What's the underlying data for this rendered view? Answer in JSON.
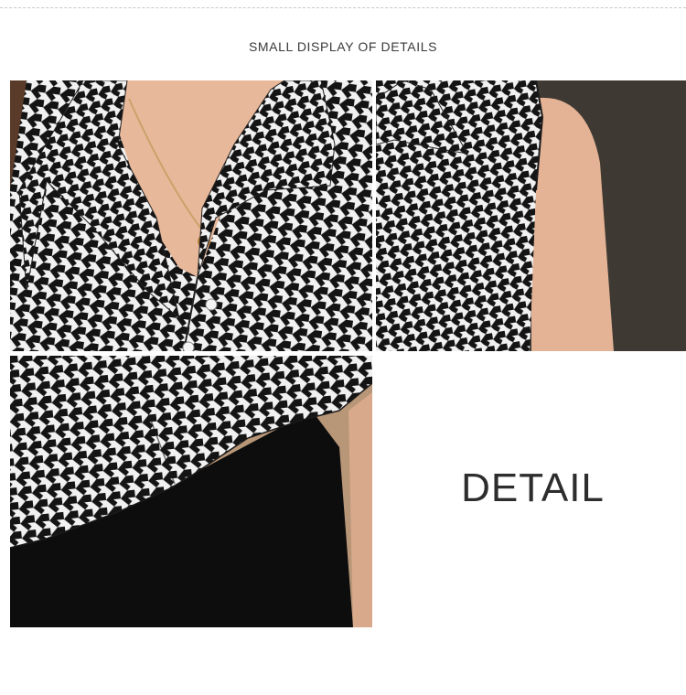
{
  "header": {
    "title": "SMALL DISPLAY OF DETAILS"
  },
  "panels": [
    {
      "name": "collar-detail-photo"
    },
    {
      "name": "shoulder-detail-photo"
    },
    {
      "name": "hem-detail-photo"
    }
  ],
  "detail_tile": {
    "label": "DETAIL"
  },
  "colors": {
    "pattern_dark": "#141414",
    "pattern_light": "#f1f1f1",
    "skin": "#e8b89a",
    "background_dark": "#3e3a33",
    "skirt_black": "#0d0d0d"
  }
}
